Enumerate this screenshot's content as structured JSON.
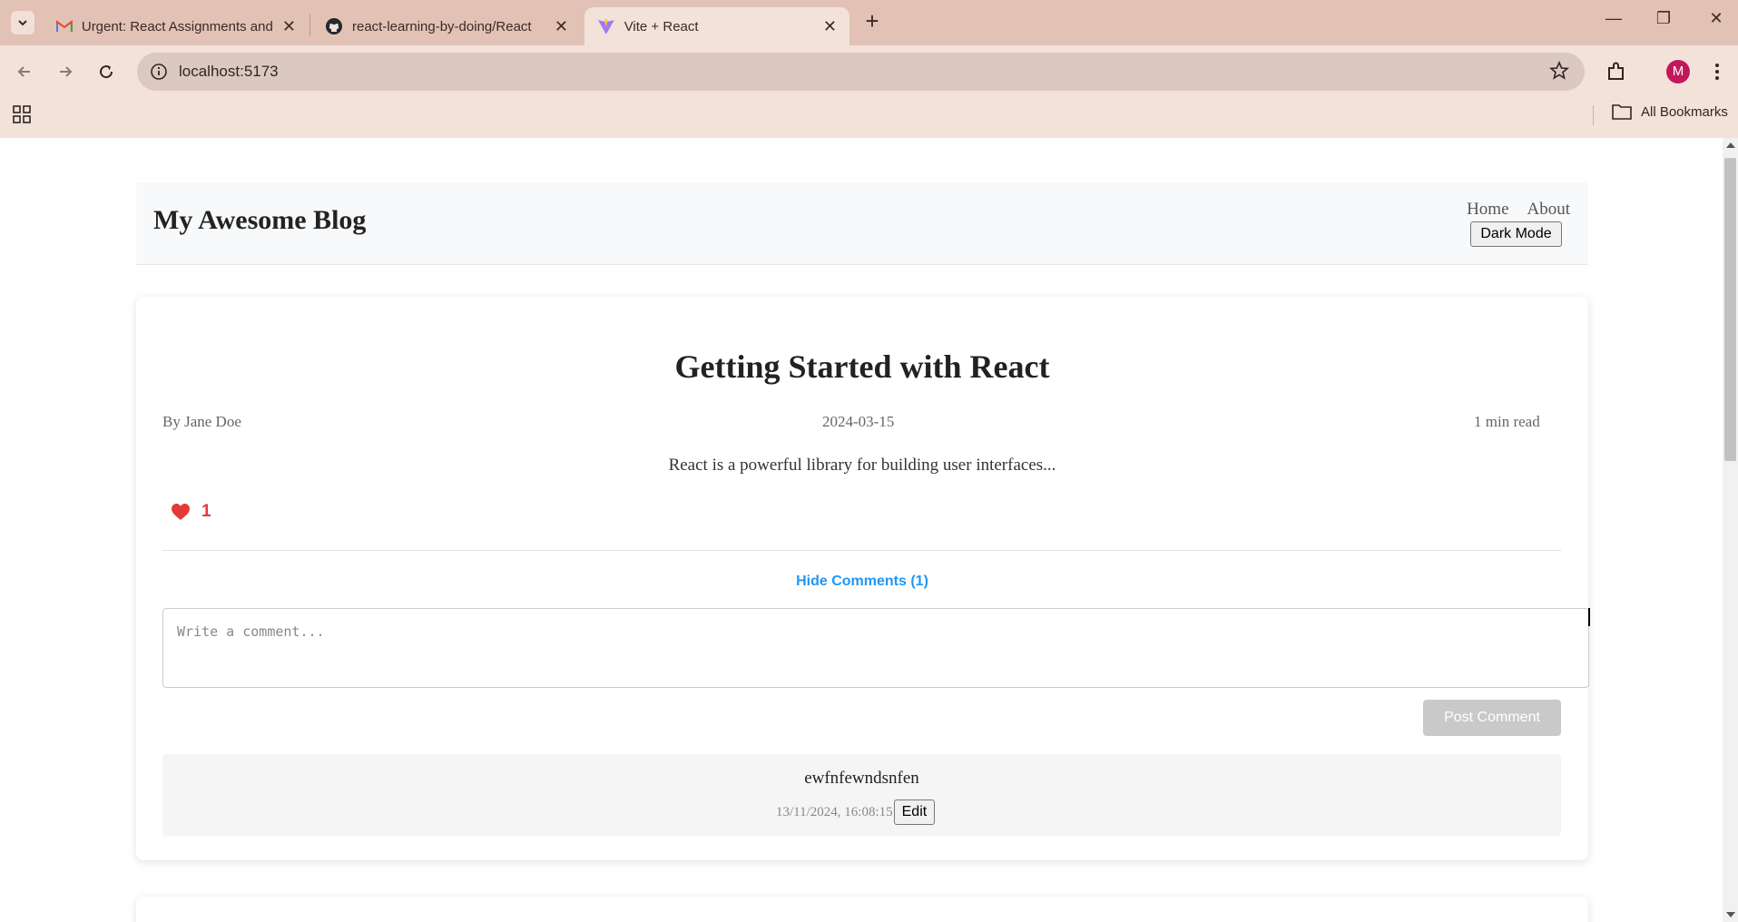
{
  "browser": {
    "tabs": [
      {
        "title": "Urgent: React Assignments and",
        "icon": "gmail-icon"
      },
      {
        "title": "react-learning-by-doing/React",
        "icon": "github-icon"
      },
      {
        "title": "Vite + React",
        "icon": "vite-icon",
        "active": true
      }
    ],
    "url": "localhost:5173",
    "profile_initial": "M",
    "bookmarks_label": "All Bookmarks"
  },
  "site": {
    "title": "My Awesome Blog",
    "nav": [
      "Home",
      "About"
    ],
    "dark_mode_label": "Dark Mode"
  },
  "post": {
    "title": "Getting Started with React",
    "author": "By Jane Doe",
    "date": "2024-03-15",
    "read_time": "1 min read",
    "excerpt": "React is a powerful library for building user interfaces...",
    "likes": "1",
    "toggle_comments_label": "Hide Comments (1)",
    "comment_placeholder": "Write a comment...",
    "post_comment_label": "Post Comment",
    "comments": [
      {
        "text": "ewfnfewndsnfen",
        "timestamp": "13/11/2024, 16:08:15",
        "edit_label": "Edit"
      }
    ]
  },
  "colors": {
    "accent_blue": "#2196f3",
    "like_red": "#e53935",
    "tabstrip": "#e2c2b5",
    "toolbar": "#f2e2da"
  }
}
